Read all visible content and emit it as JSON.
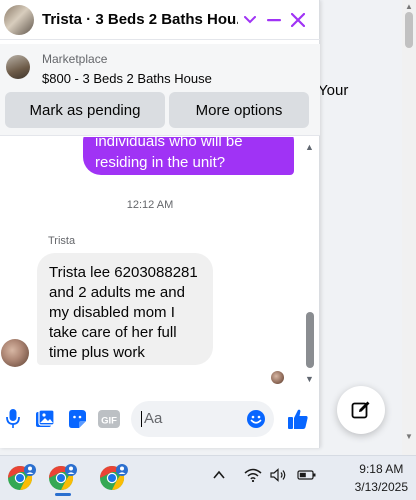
{
  "background": {
    "partial_text": "Your"
  },
  "chat": {
    "title": "Trista · 3 Beds 2 Baths Hou...",
    "header_icons": [
      "chevron-down-icon",
      "minimize-icon",
      "close-icon"
    ],
    "listing": {
      "source": "Marketplace",
      "title": "$800 - 3 Beds 2 Baths House",
      "mark_pending_label": "Mark as pending",
      "more_options_label": "More options"
    },
    "messages": {
      "outgoing_lines": [
        "individuals who will be",
        "residing in the unit?"
      ],
      "timestamp": "12:12 AM",
      "sender_name": "Trista",
      "incoming_lines": [
        "Trista lee 6203088281",
        "and 2 adults me and",
        "my disabled mom I",
        "take care of her full",
        "time plus work"
      ]
    },
    "composer": {
      "placeholder": "Aa",
      "icons": [
        "microphone-icon",
        "photo-icon",
        "sticker-icon",
        "gif-icon",
        "emoji-icon",
        "thumbs-up-icon"
      ]
    }
  },
  "colors": {
    "accent": "#a033f5",
    "messenger_blue": "#0866ff"
  },
  "taskbar": {
    "apps": [
      "chrome-profile-1",
      "chrome-profile-2",
      "chrome-profile-3"
    ],
    "tray_icons": [
      "chevron-up-icon",
      "wifi-icon",
      "volume-icon",
      "battery-icon"
    ],
    "time": "9:18 AM",
    "date": "3/13/2025"
  }
}
